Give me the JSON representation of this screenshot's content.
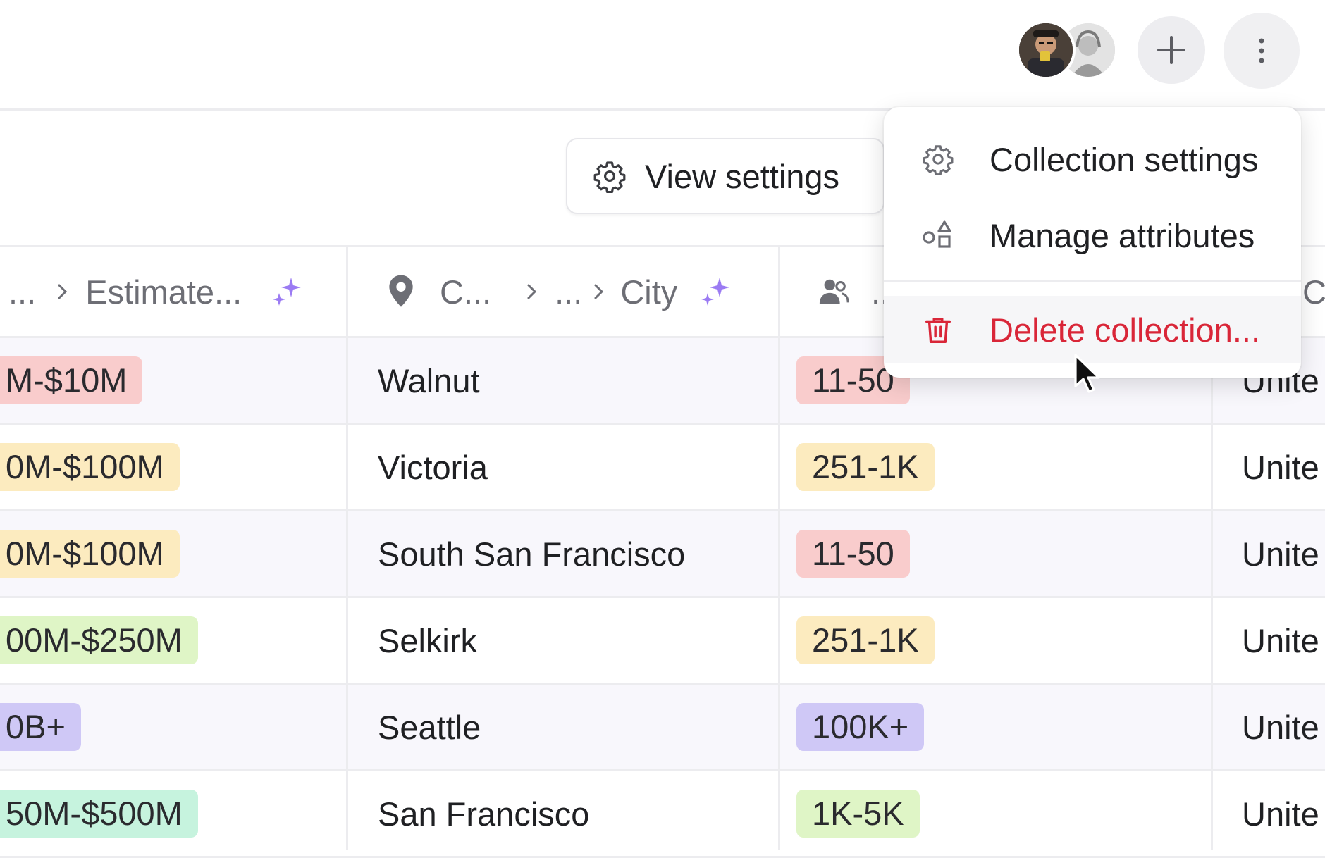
{
  "toolbar": {
    "view_settings_label": "View settings"
  },
  "columns": [
    {
      "name": "estimated-revenue",
      "path_prefix": "...",
      "label": "Estimate..."
    },
    {
      "name": "city",
      "label_a": "C...",
      "path_mid": "...",
      "label": "City"
    },
    {
      "name": "employee-range",
      "label": ".."
    },
    {
      "name": "country",
      "label": "C"
    }
  ],
  "rows": [
    {
      "revenue": "M-$10M",
      "city": "Walnut",
      "employees": "11-50",
      "country": "Unite"
    },
    {
      "revenue": "0M-$100M",
      "city": "Victoria",
      "employees": "251-1K",
      "country": "Unite"
    },
    {
      "revenue": "0M-$100M",
      "city": "South San Francisco",
      "employees": "11-50",
      "country": "Unite"
    },
    {
      "revenue": "00M-$250M",
      "city": "Selkirk",
      "employees": "251-1K",
      "country": "Unite"
    },
    {
      "revenue": "0B+",
      "city": "Seattle",
      "employees": "100K+",
      "country": "Unite"
    },
    {
      "revenue": "50M-$500M",
      "city": "San Francisco",
      "employees": "1K-5K",
      "country": "Unite"
    }
  ],
  "menu": {
    "items": [
      {
        "label": "Collection settings",
        "icon": "gear-icon"
      },
      {
        "label": "Manage attributes",
        "icon": "shapes-icon"
      },
      {
        "label": "Delete collection...",
        "icon": "trash-icon"
      }
    ]
  },
  "colors": {
    "red_tag": "#f9cccc",
    "yellow_tag": "#fcebbf",
    "green_tag": "#dff5c6",
    "purple_tag": "#cfc8f6",
    "mint_tag": "#c6f3de",
    "danger_text": "#d92638",
    "ai_sparkle": "#9b7bf3"
  }
}
